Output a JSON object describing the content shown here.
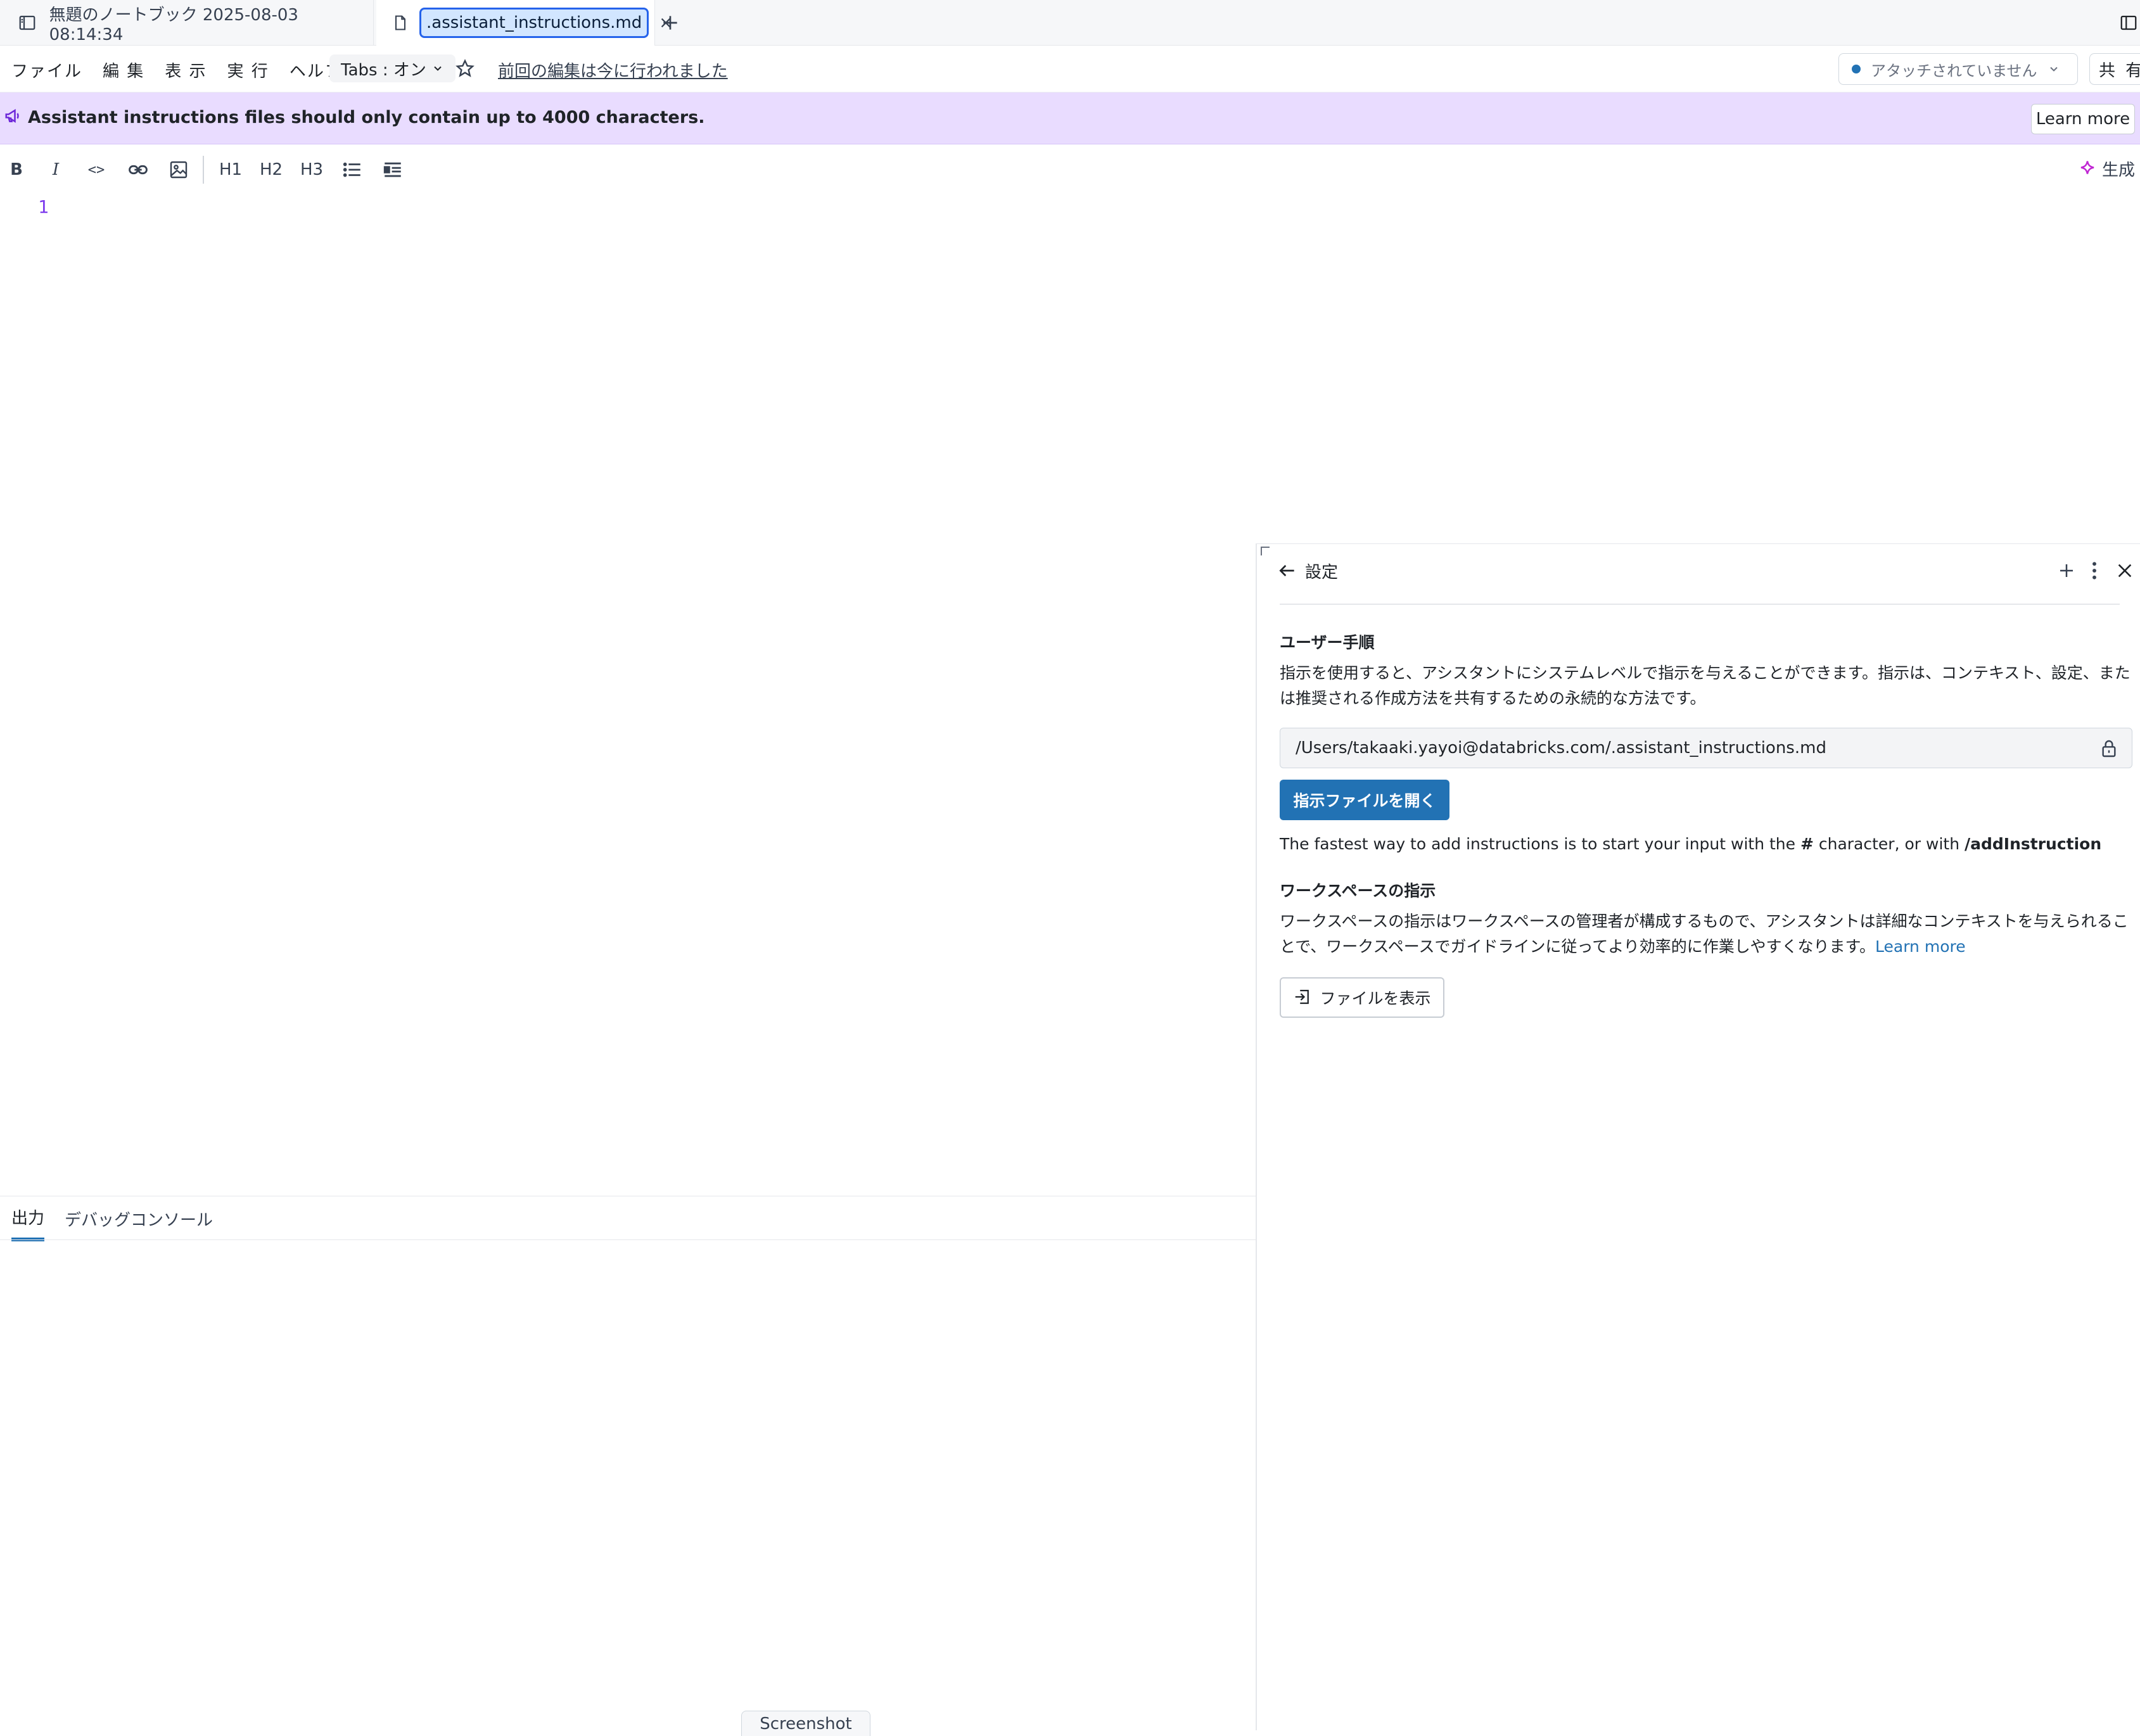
{
  "tabs": {
    "notebook_title": "無題のノートブック 2025-08-03 08:14:34",
    "active_file": ".assistant_instructions.md"
  },
  "menubar": {
    "items": [
      "ファイル",
      "編 集",
      "表 示",
      "実 行",
      "ヘルプ"
    ],
    "tabs_toggle": "Tabs : オン",
    "last_edit": "前回の編集は今に行われました",
    "attach_status": "アタッチされていません",
    "share": "共 有"
  },
  "banner": {
    "message": "Assistant instructions files should only contain up to 4000 characters.",
    "learn_more": "Learn more"
  },
  "toolbar": {
    "bold": "B",
    "italic": "I",
    "code": "<>",
    "h1": "H1",
    "h2": "H2",
    "h3": "H3",
    "generate": "生成"
  },
  "editor": {
    "line_number": "1"
  },
  "bottom_panel": {
    "tabs": [
      "出力",
      "デバッグコンソール"
    ],
    "screenshot": "Screenshot"
  },
  "settings": {
    "title": "設定",
    "user_heading": "ユーザー手順",
    "user_desc": "指示を使用すると、アシスタントにシステムレベルで指示を与えることができます。指示は、コンテキスト、設定、または推奨される作成方法を共有するための永続的な方法です。",
    "path": "/Users/takaaki.yayoi@databricks.com/.assistant_instructions.md",
    "open_button": "指示ファイルを開く",
    "fastest_pre": "The fastest way to add instructions is to start your input with the ",
    "fastest_hash": "#",
    "fastest_mid": " character, or with ",
    "fastest_cmd": "/addInstruction",
    "workspace_heading": "ワークスペースの指示",
    "workspace_desc": "ワークスペースの指示はワークスペースの管理者が構成するもので、アシスタントは詳細なコンテキストを与えられることで、ワークスペースでガイドラインに従ってより効率的に作業しやすくなります。",
    "workspace_link": "Learn more",
    "view_file_button": "ファイルを表示"
  },
  "colors": {
    "accent": "#2272b4",
    "banner_bg": "#e9dcff",
    "active_tab_highlight": "#d2e6ff",
    "line_number": "#7c3aed"
  }
}
